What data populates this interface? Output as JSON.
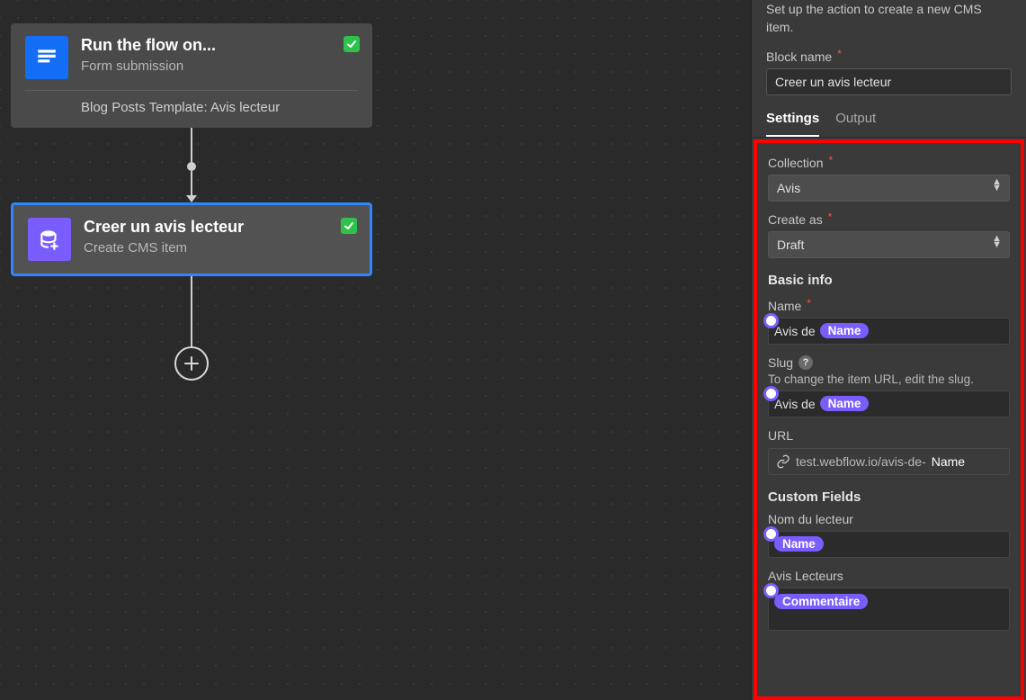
{
  "flow": {
    "trigger": {
      "title": "Run the flow on...",
      "subtitle": "Form submission",
      "detail": "Blog Posts Template: Avis lecteur"
    },
    "action": {
      "title": "Creer un avis lecteur",
      "subtitle": "Create CMS item"
    }
  },
  "panel": {
    "help": "Set up the action to create a new CMS item.",
    "block_name_label": "Block name",
    "block_name_value": "Creer un avis lecteur",
    "tabs": {
      "settings": "Settings",
      "output": "Output"
    },
    "collection": {
      "label": "Collection",
      "value": "Avis"
    },
    "create_as": {
      "label": "Create as",
      "value": "Draft"
    },
    "basic_info": {
      "heading": "Basic info",
      "name_label": "Name",
      "name_prefix": "Avis de",
      "name_token": "Name",
      "slug_label": "Slug",
      "slug_hint": "To change the item URL, edit the slug.",
      "slug_prefix": "Avis de",
      "slug_token": "Name",
      "url_label": "URL",
      "url_prefix": "test.webflow.io/avis-de-",
      "url_token": "Name"
    },
    "custom_fields": {
      "heading": "Custom Fields",
      "nom_label": "Nom du lecteur",
      "nom_token": "Name",
      "avis_label": "Avis Lecteurs",
      "avis_token": "Commentaire"
    }
  }
}
